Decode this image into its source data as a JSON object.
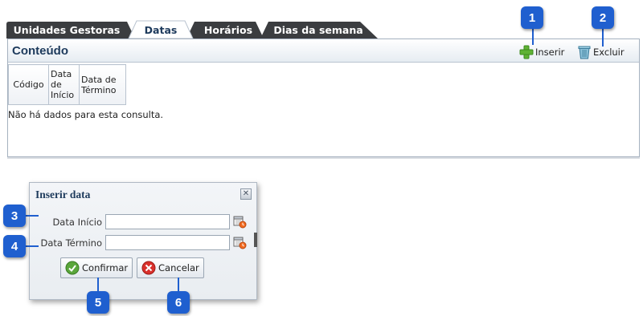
{
  "tabs": [
    {
      "label": "Unidades Gestoras"
    },
    {
      "label": "Datas"
    },
    {
      "label": "Horários"
    },
    {
      "label": "Dias da semana"
    }
  ],
  "panel": {
    "title": "Conteúdo",
    "insert_label": "Inserir",
    "delete_label": "Excluir",
    "columns": [
      "Código",
      "Data de Início",
      "Data de Término"
    ],
    "empty_message": "Não há dados para esta consulta."
  },
  "dialog": {
    "title": "Inserir data",
    "start_label": "Data Início",
    "end_label": "Data Término",
    "start_value": "",
    "end_value": "",
    "confirm_label": "Confirmar",
    "cancel_label": "Cancelar"
  },
  "callouts": [
    "1",
    "2",
    "3",
    "4",
    "5",
    "6"
  ],
  "icons": {
    "insert": "plus-icon",
    "delete": "trash-icon",
    "close": "close-icon",
    "calendar": "calendar-icon",
    "confirm": "check-icon",
    "cancel": "cancel-icon"
  },
  "colors": {
    "callout": "#1f5fcf",
    "tab_dark": "#3b3d40",
    "title": "#1d3a5c"
  }
}
